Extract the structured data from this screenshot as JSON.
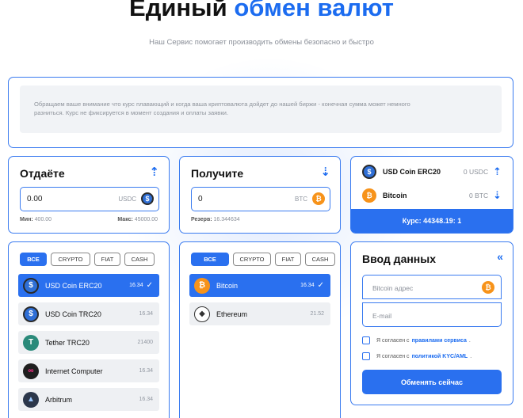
{
  "header": {
    "title_part1": "Единый",
    "title_part2": "обмен валют",
    "subtitle": "Наш Сервис помогает производить обмены безопасно и быстро"
  },
  "notice": {
    "line1": "Обращаем ваше внимание что курс плавающий и когда ваша криптовалюта дойдет до нашей биржи - конечная сумма может немного",
    "line2": "разниться. Курс не фиксируется в момент создания и оплаты заявки."
  },
  "give": {
    "title": "Отдаёте",
    "value": "0.00",
    "currency": "USDC",
    "min_label": "Мин:",
    "min_value": "400.00",
    "max_label": "Макс:",
    "max_value": "45000.00"
  },
  "get": {
    "title": "Получите",
    "value": "0",
    "currency": "BTC",
    "reserve_label": "Резерв:",
    "reserve_value": "16.344634"
  },
  "summary": {
    "from_name": "USD Coin ERC20",
    "from_amount": "0 USDC",
    "to_name": "Bitcoin",
    "to_amount": "0 BTC",
    "rate": "Курс: 44348.19: 1"
  },
  "filters": [
    "ВСЕ",
    "CRYPTO",
    "FIAT",
    "CASH"
  ],
  "give_list": [
    {
      "name": "USD Coin ERC20",
      "reserve": "16.34",
      "active": true
    },
    {
      "name": "USD Coin TRC20",
      "reserve": "16.34",
      "active": false
    },
    {
      "name": "Tether TRC20",
      "reserve": "21400",
      "active": false
    },
    {
      "name": "Internet Computer",
      "reserve": "16.34",
      "active": false
    },
    {
      "name": "Arbitrum",
      "reserve": "16.34",
      "active": false
    }
  ],
  "get_list": [
    {
      "name": "Bitcoin",
      "reserve": "16.34",
      "active": true
    },
    {
      "name": "Ethereum",
      "reserve": "21.52",
      "active": false
    }
  ],
  "form": {
    "title": "Ввод данных",
    "address_placeholder": "Bitcoin адрес",
    "email_placeholder": "E-mail",
    "agree1_prefix": "Я согласен с",
    "agree1_link": "правилами сервиса",
    "agree2_prefix": "Я согласен с",
    "agree2_link": "политикой KYC/AML",
    "dot": ".",
    "submit": "Обменять сейчас"
  },
  "colors": {
    "accent": "#2a70ef",
    "btc": "#f7931a"
  }
}
